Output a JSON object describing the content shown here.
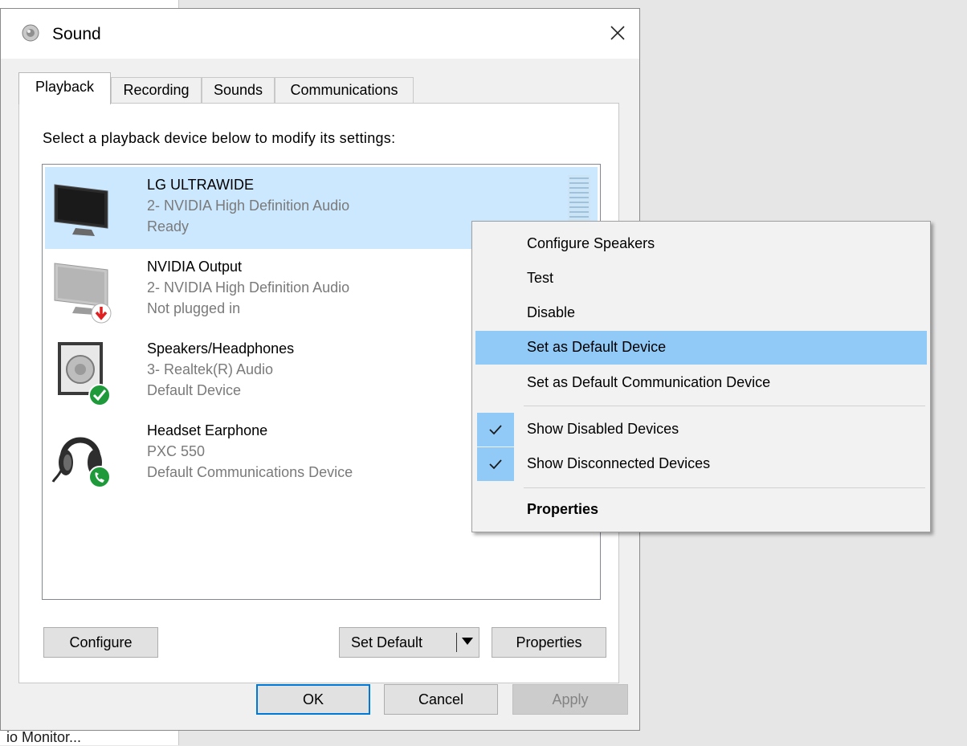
{
  "window": {
    "title": "Sound"
  },
  "tabs": [
    {
      "label": "Playback",
      "active": true
    },
    {
      "label": "Recording",
      "active": false
    },
    {
      "label": "Sounds",
      "active": false
    },
    {
      "label": "Communications",
      "active": false
    }
  ],
  "playback": {
    "instruction": "Select a playback device below to modify its settings:",
    "devices": [
      {
        "name": "LG ULTRAWIDE",
        "driver": "2- NVIDIA High Definition Audio",
        "status": "Ready",
        "icon": "monitor-icon",
        "selected": true
      },
      {
        "name": "NVIDIA Output",
        "driver": "2- NVIDIA High Definition Audio",
        "status": "Not plugged in",
        "icon": "monitor-disconnected-icon",
        "selected": false
      },
      {
        "name": "Speakers/Headphones",
        "driver": "3- Realtek(R) Audio",
        "status": "Default Device",
        "icon": "speaker-default-icon",
        "selected": false
      },
      {
        "name": "Headset Earphone",
        "driver": "PXC 550",
        "status": "Default Communications Device",
        "icon": "headset-communications-icon",
        "selected": false
      }
    ],
    "buttons": {
      "configure": "Configure",
      "set_default": "Set Default",
      "properties": "Properties"
    }
  },
  "footer": {
    "ok": "OK",
    "cancel": "Cancel",
    "apply": "Apply"
  },
  "context_menu": {
    "items": [
      {
        "label": "Configure Speakers"
      },
      {
        "label": "Test"
      },
      {
        "label": "Disable"
      },
      {
        "label": "Set as Default Device",
        "highlighted": true
      },
      {
        "label": "Set as Default Communication Device"
      },
      {
        "label": "Show Disabled Devices",
        "checked": true
      },
      {
        "label": "Show Disconnected Devices",
        "checked": true
      },
      {
        "label": "Properties",
        "bold": true
      }
    ]
  },
  "background": {
    "partial_text": "io Monitor..."
  },
  "colors": {
    "selection": "#cce8ff",
    "menu_highlight": "#91c9f7",
    "ok_default_border": "#0078d7",
    "green_status": "#1e9a3a",
    "red_status": "#e02020"
  }
}
